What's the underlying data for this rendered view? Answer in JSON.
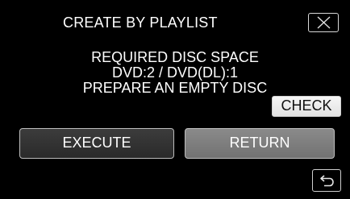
{
  "dialog": {
    "title": "CREATE BY PLAYLIST",
    "close_icon": "close-icon"
  },
  "message": {
    "line1": "REQUIRED DISC SPACE",
    "line2": "DVD:2 / DVD(DL):1",
    "line3": "PREPARE AN EMPTY DISC"
  },
  "buttons": {
    "check": "CHECK",
    "execute": "EXECUTE",
    "return": "RETURN",
    "back_icon": "back-arrow-icon"
  }
}
